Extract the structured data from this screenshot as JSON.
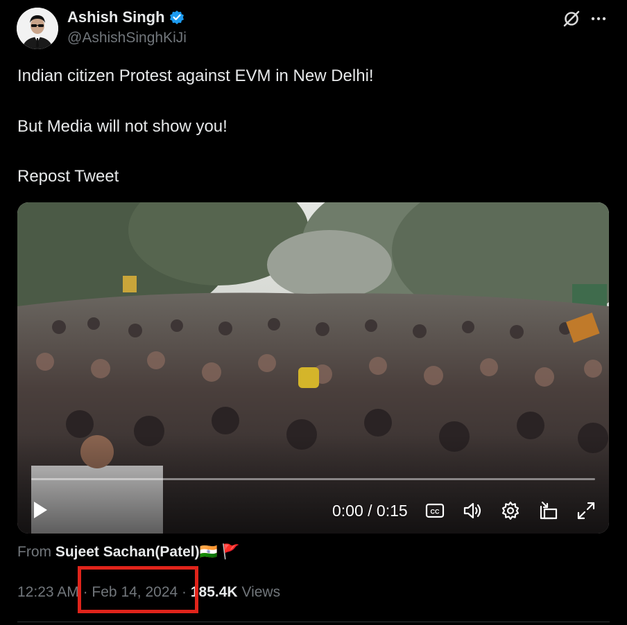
{
  "author": {
    "display_name": "Ashish Singh",
    "handle": "@AshishSinghKiJi",
    "verified": true
  },
  "header_icons": [
    "grok-icon",
    "more-icon"
  ],
  "tweet": {
    "lines": [
      "Indian citizen Protest against EVM in New Delhi!",
      "But Media will not show you!",
      "Repost Tweet"
    ]
  },
  "video": {
    "time_display": "0:00 / 0:15",
    "progress": 0,
    "controls": [
      "play-icon",
      "captions-icon",
      "volume-icon",
      "settings-icon",
      "pip-icon",
      "fullscreen-icon"
    ]
  },
  "source": {
    "prefix": "From",
    "name": "Sujeet Sachan(Patel)",
    "emoji_flags": "🇮🇳 🚩"
  },
  "meta": {
    "time": "12:23 AM",
    "separator": "·",
    "date": "Feb 14, 2024",
    "views_count": "185.4K",
    "views_label": "Views"
  },
  "colors": {
    "background": "#000000",
    "text": "#e7e9ea",
    "muted": "#71767b",
    "verified": "#1d9bf0",
    "highlight": "#e0241b"
  }
}
